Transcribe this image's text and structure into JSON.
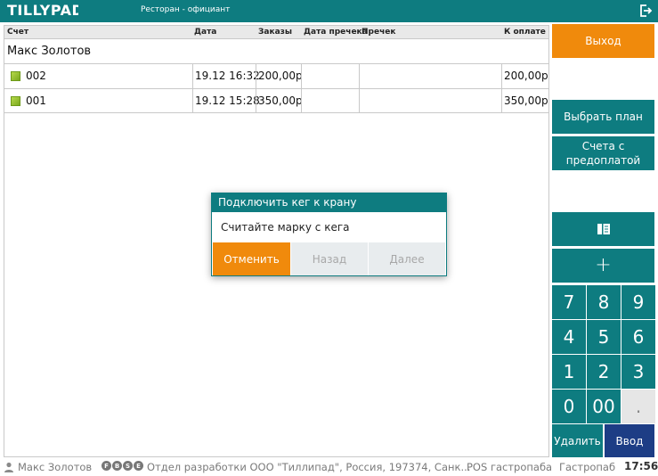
{
  "header": {
    "logo_text": "TILLYPAD",
    "title": "Ресторан - официант",
    "exit_icon": "logout-icon"
  },
  "table": {
    "columns": [
      "Счет",
      "Дата",
      "Заказы",
      "Дата пречека",
      "Пречек",
      "К оплате"
    ],
    "group_title": "Макс Золотов",
    "rows": [
      {
        "account": "002",
        "date": "19.12 16:32",
        "orders": "200,00р",
        "precheck_date": "",
        "precheck": "",
        "to_pay": "200,00р"
      },
      {
        "account": "001",
        "date": "19.12 15:28",
        "orders": "350,00р",
        "precheck_date": "",
        "precheck": "",
        "to_pay": "350,00р"
      }
    ]
  },
  "dialog": {
    "title": "Подключить кег к крану",
    "message": "Считайте марку с кега",
    "cancel_label": "Отменить",
    "back_label": "Назад",
    "next_label": "Далее"
  },
  "right_panel": {
    "exit_label": "Выход",
    "choose_plan_label": "Выбрать план",
    "prepaid_label": "Счета с\nпредоплатой",
    "book_icon": "book-icon",
    "plus_label": "+",
    "keys": [
      "7",
      "8",
      "9",
      "4",
      "5",
      "6",
      "1",
      "2",
      "3",
      "0",
      "00",
      "."
    ],
    "delete_label": "Удалить",
    "enter_label": "Ввод"
  },
  "statusbar": {
    "user_name": "Макс Золотов",
    "badges": [
      "F",
      "B",
      "S",
      "E"
    ],
    "organization": "Отдел разработки ООО \"Тиллипад\", Россия, 197374, Санк...",
    "pos_name": "POS гастропаба",
    "terminal": "Гастропаб",
    "time": "17:56"
  },
  "colors": {
    "teal": "#0e7c80",
    "orange": "#f08a0c",
    "navy": "#1d3d85"
  }
}
